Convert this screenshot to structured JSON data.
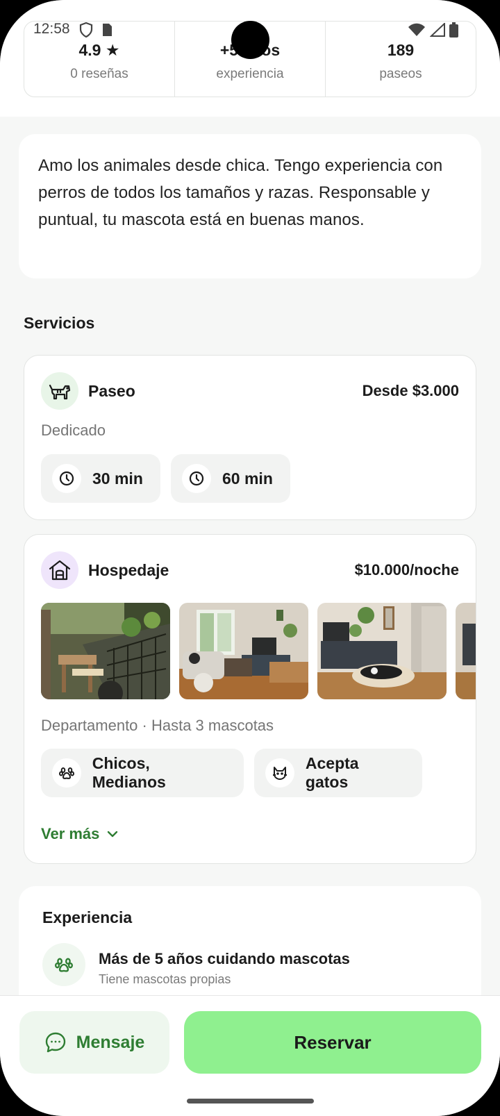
{
  "status_bar": {
    "time": "12:58",
    "left_icons": [
      "shield-icon",
      "sim-card-icon"
    ],
    "right_icons": [
      "wifi-icon",
      "signal-icon",
      "battery-icon"
    ]
  },
  "stats": [
    {
      "value": "4.9 ★",
      "label": "0 reseñas"
    },
    {
      "value": "+5 años",
      "label": "experiencia"
    },
    {
      "value": "189",
      "label": "paseos"
    }
  ],
  "bio": "Amo los animales desde chica. Tengo experiencia con perros de todos los tamaños y razas. Responsable y puntual, tu mascota está en buenas manos.",
  "services_title": "Servicios",
  "paseo": {
    "name": "Paseo",
    "price": "Desde $3.000",
    "subtitle": "Dedicado",
    "durations": [
      "30 min",
      "60 min"
    ],
    "icon": "dog-icon",
    "icon_bg": "#e8f5e8"
  },
  "hospedaje": {
    "name": "Hospedaje",
    "price": "$10.000/noche",
    "subtitle": "Departamento · Hasta 3 mascotas",
    "chips": [
      {
        "icon": "paw-icon",
        "label": "Chicos, Medianos"
      },
      {
        "icon": "cat-icon",
        "label": "Acepta gatos"
      }
    ],
    "ver_mas": "Ver más",
    "icon": "house-icon",
    "icon_bg": "#efe5fb",
    "photos": [
      "balcony-photo",
      "living-room-photo",
      "living-room-dog-bed-photo",
      "room-photo"
    ]
  },
  "experience": {
    "title": "Experiencia",
    "main": "Más de 5 años cuidando mascotas",
    "sub": "Tiene mascotas propias"
  },
  "actions": {
    "message": "Mensaje",
    "reserve": "Reservar"
  },
  "colors": {
    "accent_green": "#2e7d32",
    "reserve_bg": "#8ff08f",
    "message_bg": "#eef7ee"
  }
}
